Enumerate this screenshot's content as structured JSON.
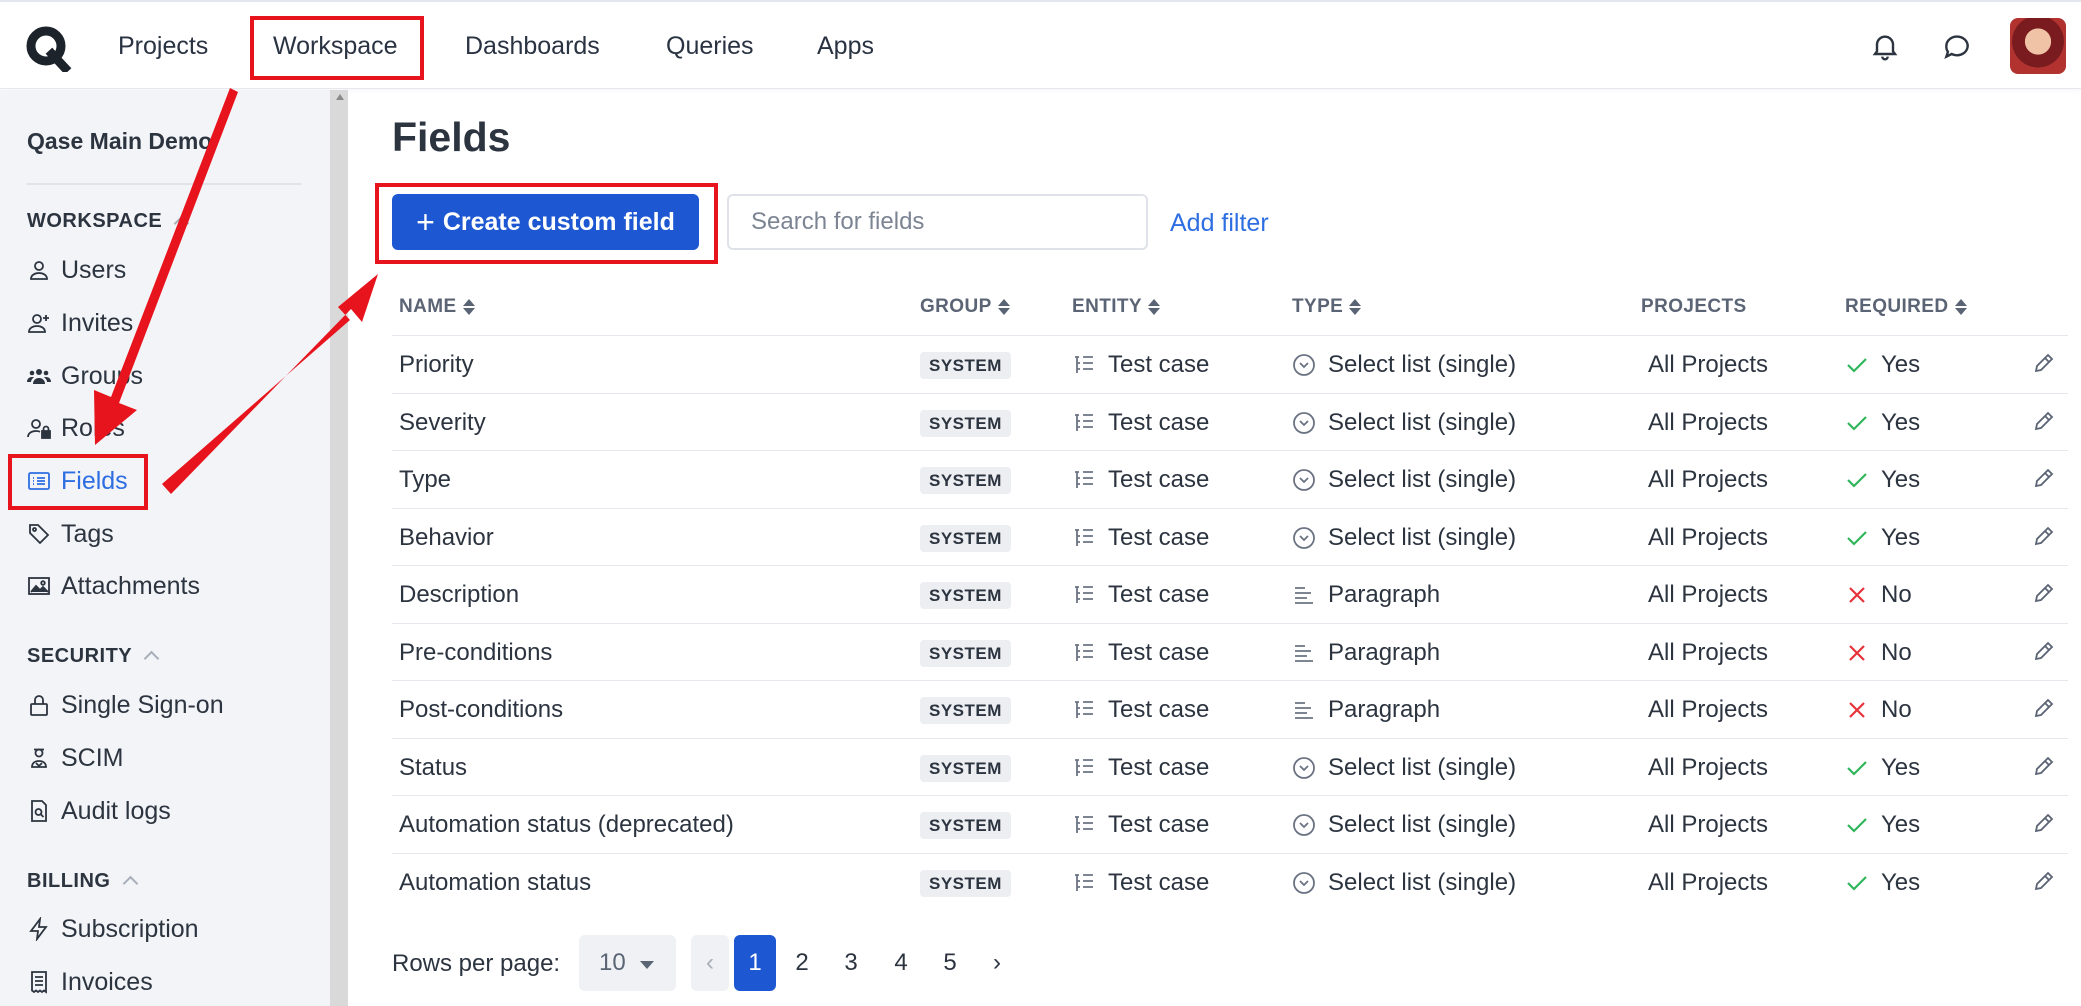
{
  "topnav": {
    "items": [
      "Projects",
      "Workspace",
      "Dashboards",
      "Queries",
      "Apps"
    ],
    "active": "Workspace"
  },
  "sidebar": {
    "org_name": "Qase Main Demo",
    "sections": [
      {
        "title": "WORKSPACE",
        "items": [
          {
            "label": "Users",
            "icon": "user-icon"
          },
          {
            "label": "Invites",
            "icon": "user-plus-icon"
          },
          {
            "label": "Groups",
            "icon": "users-group-icon"
          },
          {
            "label": "Roles",
            "icon": "user-lock-icon"
          },
          {
            "label": "Fields",
            "icon": "list-icon"
          },
          {
            "label": "Tags",
            "icon": "tag-icon"
          },
          {
            "label": "Attachments",
            "icon": "image-icon"
          }
        ]
      },
      {
        "title": "SECURITY",
        "items": [
          {
            "label": "Single Sign-on",
            "icon": "lock-icon"
          },
          {
            "label": "SCIM",
            "icon": "scim-icon"
          },
          {
            "label": "Audit logs",
            "icon": "audit-file-icon"
          }
        ]
      },
      {
        "title": "BILLING",
        "items": [
          {
            "label": "Subscription",
            "icon": "bolt-icon"
          },
          {
            "label": "Invoices",
            "icon": "invoice-icon"
          }
        ]
      }
    ],
    "active_item": "Fields"
  },
  "main": {
    "title": "Fields",
    "create_button": "Create custom field",
    "search_placeholder": "Search for fields",
    "add_filter": "Add filter",
    "columns": [
      "NAME",
      "GROUP",
      "ENTITY",
      "TYPE",
      "PROJECTS",
      "REQUIRED"
    ],
    "rows": [
      {
        "name": "Priority",
        "group": "SYSTEM",
        "entity": "Test case",
        "type": "Select list (single)",
        "projects": "All Projects",
        "required": "Yes"
      },
      {
        "name": "Severity",
        "group": "SYSTEM",
        "entity": "Test case",
        "type": "Select list (single)",
        "projects": "All Projects",
        "required": "Yes"
      },
      {
        "name": "Type",
        "group": "SYSTEM",
        "entity": "Test case",
        "type": "Select list (single)",
        "projects": "All Projects",
        "required": "Yes"
      },
      {
        "name": "Behavior",
        "group": "SYSTEM",
        "entity": "Test case",
        "type": "Select list (single)",
        "projects": "All Projects",
        "required": "Yes"
      },
      {
        "name": "Description",
        "group": "SYSTEM",
        "entity": "Test case",
        "type": "Paragraph",
        "projects": "All Projects",
        "required": "No"
      },
      {
        "name": "Pre-conditions",
        "group": "SYSTEM",
        "entity": "Test case",
        "type": "Paragraph",
        "projects": "All Projects",
        "required": "No"
      },
      {
        "name": "Post-conditions",
        "group": "SYSTEM",
        "entity": "Test case",
        "type": "Paragraph",
        "projects": "All Projects",
        "required": "No"
      },
      {
        "name": "Status",
        "group": "SYSTEM",
        "entity": "Test case",
        "type": "Select list (single)",
        "projects": "All Projects",
        "required": "Yes"
      },
      {
        "name": "Automation status (deprecated)",
        "group": "SYSTEM",
        "entity": "Test case",
        "type": "Select list (single)",
        "projects": "All Projects",
        "required": "Yes"
      },
      {
        "name": "Automation status",
        "group": "SYSTEM",
        "entity": "Test case",
        "type": "Select list (single)",
        "projects": "All Projects",
        "required": "Yes"
      }
    ],
    "pagination": {
      "rows_per_page_label": "Rows per page:",
      "rows_per_page": "10",
      "prev": "‹",
      "next": "›",
      "pages": [
        "1",
        "2",
        "3",
        "4",
        "5"
      ],
      "current_page": "1"
    }
  },
  "colors": {
    "accent": "#1e57d2",
    "link": "#2d6ee2",
    "annotation_red": "#e8141d",
    "check_green": "#2fb65b",
    "cross_red": "#e8323a"
  }
}
